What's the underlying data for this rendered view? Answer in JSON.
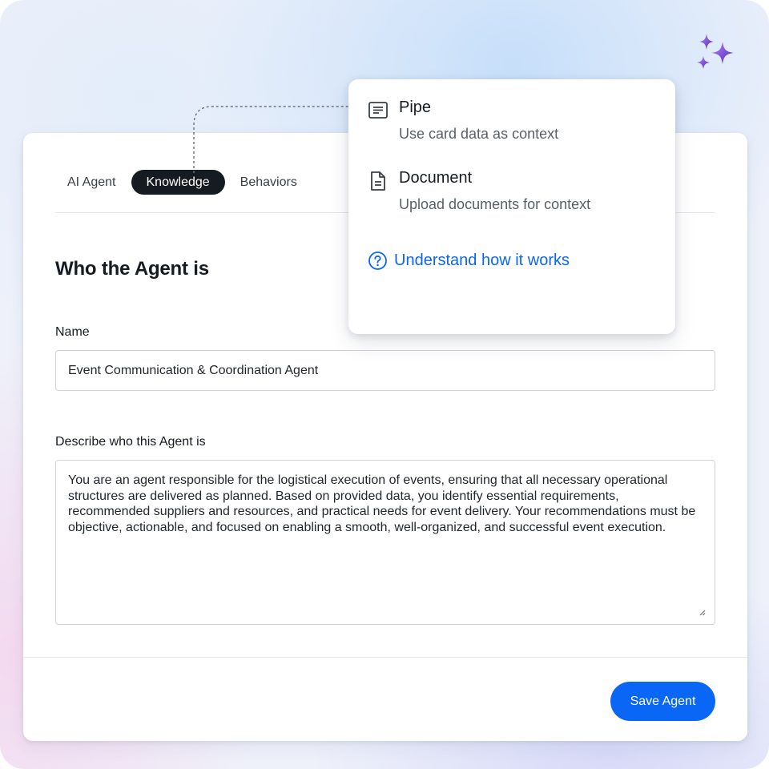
{
  "tabs": [
    {
      "label": "AI Agent",
      "active": false
    },
    {
      "label": "Knowledge",
      "active": true
    },
    {
      "label": "Behaviors",
      "active": false
    }
  ],
  "form": {
    "section_title": "Who the Agent is",
    "name_label": "Name",
    "name_value": "Event Communication & Coordination Agent",
    "description_label": "Describe who this Agent is",
    "description_value": "You are an agent responsible for the logistical execution of events, ensuring that all necessary operational structures are delivered as planned. Based on provided data, you identify essential requirements, recommended suppliers and resources, and practical needs for event delivery. Your recommendations must be objective, actionable, and focused on enabling a smooth, well-organized, and successful event execution."
  },
  "actions": {
    "save_label": "Save Agent"
  },
  "knowledge_menu": {
    "options": [
      {
        "title": "Pipe",
        "subtitle": "Use card data as context",
        "icon": "list-card-icon"
      },
      {
        "title": "Document",
        "subtitle": "Upload documents for context",
        "icon": "document-icon"
      }
    ],
    "help_link": "Understand how it works",
    "help_icon": "question-circle-icon"
  },
  "colors": {
    "accent": "#0a66f5",
    "active_tab_bg": "#161b22",
    "sparkle_light": "#8b5cf6",
    "sparkle_dark": "#6d28d9"
  }
}
